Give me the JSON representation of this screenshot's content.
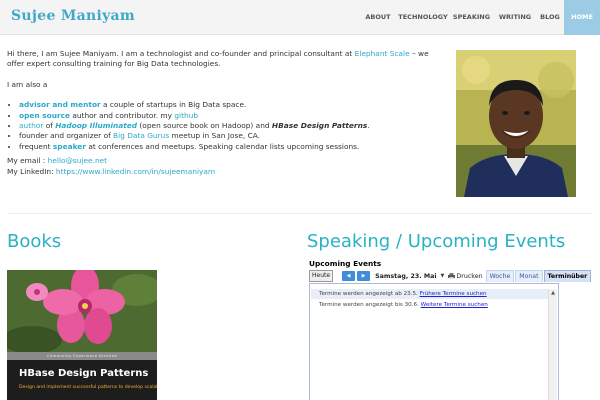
{
  "site": {
    "brand": "Sujee Maniyam"
  },
  "nav": {
    "items": [
      {
        "label": "ABOUT",
        "width": 38
      },
      {
        "label": "TECHNOLOGY",
        "width": 52
      },
      {
        "label": "SPEAKING",
        "width": 45
      },
      {
        "label": "WRITING",
        "width": 42
      },
      {
        "label": "BLOG",
        "width": 28
      },
      {
        "label": "HOME",
        "width": 36,
        "active": true
      }
    ]
  },
  "intro": {
    "greeting": "Hi there, I am Sujee Maniyam.   I am a technologist and co-founder and principal consultant at ",
    "company_link": "Elephant Scale",
    "greeting_end": " – we offer expert consulting training for Big Data technologies.",
    "also": "I am also a",
    "items": [
      {
        "bold": "advisor and mentor",
        "text": " a couple of startups in Big Data space."
      },
      {
        "bold": "open source",
        "text": " author  and contributor. my ",
        "link": "github"
      },
      {
        "lead": "author",
        "of": " of ",
        "book": "Hadoop Illuminated",
        "mid": " (open source book on Hadoop) and ",
        "book2": "HBase Design Patterns",
        "end": "."
      },
      {
        "text": "founder and organizer of ",
        "link": "Big Data Gurus",
        "end": " meetup in San Jose, CA."
      },
      {
        "text": "frequent ",
        "bold": "speaker",
        "end": " at conferences and meetups.   Speaking calendar lists upcoming sessions."
      }
    ],
    "email_label": "My email  : ",
    "email": "hello@sujee.net",
    "linkedin_label": "My LinkedIn: ",
    "linkedin": "https://www.linkedin.com/in/sujeemaniyam"
  },
  "books": {
    "title": "Books",
    "cover_strip": "Community  Experience  Distilled",
    "cover_title": "HBase Design Patterns",
    "cover_sub": "Design and implement successful patterns to develop scalable"
  },
  "events": {
    "title": "Speaking / Upcoming Events",
    "calendar": {
      "heading": "Upcoming Events",
      "today": "Heute",
      "prev": "◀",
      "next": "▶",
      "date": "Samstag, 23. Mai",
      "dropdown": "▼",
      "print": "Drucken",
      "tabs": [
        "Woche",
        "Monat",
        "Terminüber"
      ],
      "row1_text": "Termine werden angezeigt ab 23.5.  ",
      "row1_link": "Frühere Termine suchen",
      "row2_text": "Termine werden angezeigt bis 30.6.  ",
      "row2_link": "Weitere Termine suchen",
      "scroll_up": "▲"
    }
  },
  "colors": {
    "accent": "#2ab1c6",
    "link": "#2aaac8",
    "nav_active": "#9ccbe6",
    "header_bg": "#f4f4f4"
  }
}
